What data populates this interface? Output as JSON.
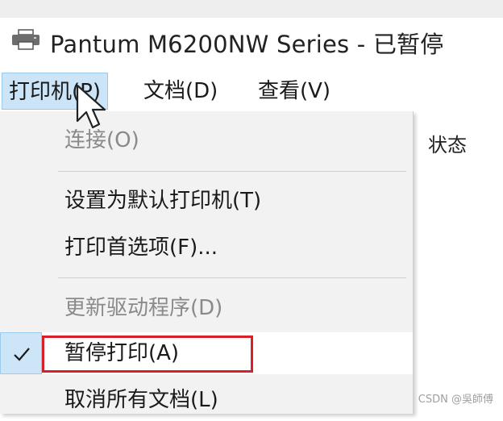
{
  "window": {
    "title": "Pantum M6200NW Series - 已暂停",
    "icon": "printer-icon"
  },
  "menubar": {
    "items": [
      {
        "label": "打印机(P)",
        "active": true
      },
      {
        "label": "文档(D)",
        "active": false
      },
      {
        "label": "查看(V)",
        "active": false
      }
    ]
  },
  "content": {
    "column_header": "状态"
  },
  "printer_menu": {
    "items": [
      {
        "label": "连接(O)",
        "enabled": false
      },
      {
        "label": "设置为默认打印机(T)",
        "enabled": true
      },
      {
        "label": "打印首选项(F)...",
        "enabled": true
      },
      {
        "label": "更新驱动程序(D)",
        "enabled": false
      },
      {
        "label": "暂停打印(A)",
        "enabled": true,
        "checked": true,
        "highlighted": true
      },
      {
        "label": "取消所有文档(L)",
        "enabled": true
      }
    ]
  },
  "watermark": "CSDN @吳師傅",
  "colors": {
    "highlight_border": "#d6202a",
    "active_menu_bg": "#cce4f7",
    "check_gutter_bg": "#cde6f7"
  }
}
